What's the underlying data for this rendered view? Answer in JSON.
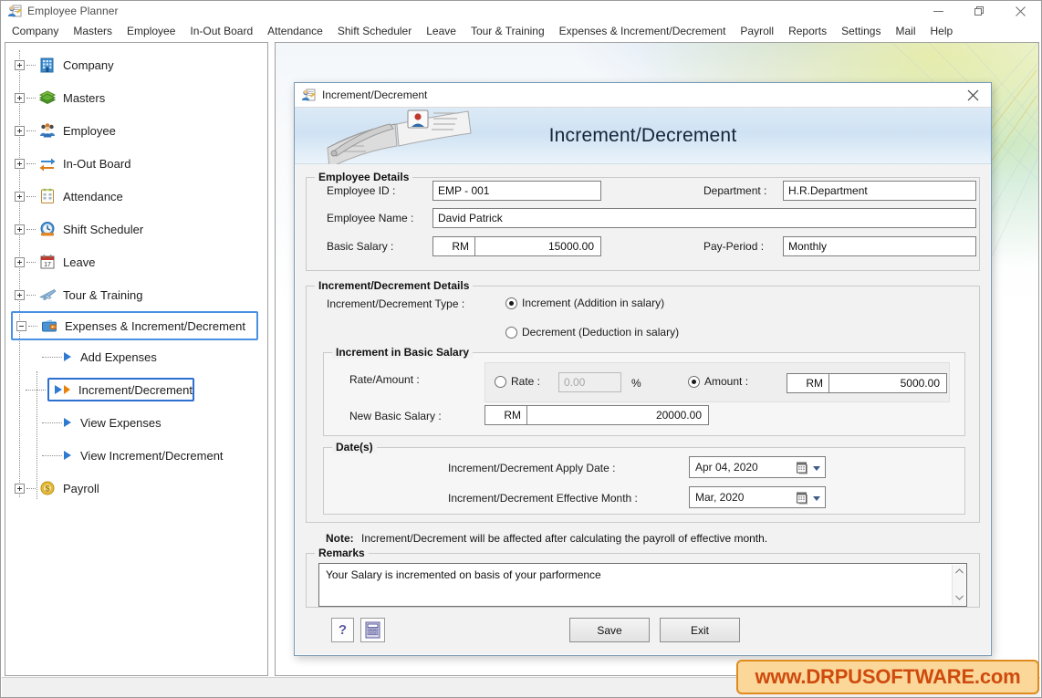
{
  "window": {
    "title": "Employee Planner",
    "app_icon": "employee-planner-icon",
    "minimize": "—",
    "maximize": "❐",
    "close": "✕"
  },
  "menubar": {
    "items": [
      "Company",
      "Masters",
      "Employee",
      "In-Out Board",
      "Attendance",
      "Shift Scheduler",
      "Leave",
      "Tour & Training",
      "Expenses & Increment/Decrement",
      "Payroll",
      "Reports",
      "Settings",
      "Mail",
      "Help"
    ]
  },
  "sidebar": {
    "nodes": [
      {
        "label": "Company",
        "icon": "building-icon",
        "state": "collapsed"
      },
      {
        "label": "Masters",
        "icon": "layers-icon",
        "state": "collapsed"
      },
      {
        "label": "Employee",
        "icon": "people-icon",
        "state": "collapsed"
      },
      {
        "label": "In-Out Board",
        "icon": "arrows-swap-icon",
        "state": "collapsed"
      },
      {
        "label": "Attendance",
        "icon": "clipboard-icon",
        "state": "collapsed"
      },
      {
        "label": "Shift Scheduler",
        "icon": "clock-icon",
        "state": "collapsed"
      },
      {
        "label": "Leave",
        "icon": "calendar-17-icon",
        "state": "collapsed"
      },
      {
        "label": "Tour & Training",
        "icon": "airplane-icon",
        "state": "collapsed"
      },
      {
        "label": "Expenses & Increment/Decrement",
        "icon": "wallet-icon",
        "state": "expanded",
        "selected": true
      },
      {
        "label": "Payroll",
        "icon": "coin-icon",
        "state": "collapsed"
      }
    ],
    "children": [
      {
        "label": "Add Expenses",
        "icon": "arrow-right-icon",
        "selected": false
      },
      {
        "label": "Increment/Decrement",
        "icon": "double-arrow-right-icon",
        "selected": true
      },
      {
        "label": "View Expenses",
        "icon": "arrow-right-icon",
        "selected": false
      },
      {
        "label": "View Increment/Decrement",
        "icon": "arrow-right-icon",
        "selected": false
      }
    ]
  },
  "dialog": {
    "titlebar": {
      "icon": "increment-decrement-icon",
      "title": "Increment/Decrement",
      "close": "✕"
    },
    "header": {
      "title": "Increment/Decrement",
      "image": "notebook-pen-icon"
    },
    "employee_details": {
      "legend": "Employee Details",
      "employee_id_label": "Employee ID :",
      "employee_id_value": "EMP - 001",
      "department_label": "Department :",
      "department_value": "H.R.Department",
      "employee_name_label": "Employee Name :",
      "employee_name_value": "David Patrick",
      "basic_salary_label": "Basic Salary :",
      "basic_salary_currency": "RM",
      "basic_salary_value": "15000.00",
      "pay_period_label": "Pay-Period :",
      "pay_period_value": "Monthly"
    },
    "incdec_details": {
      "legend": "Increment/Decrement Details",
      "type_label": "Increment/Decrement Type :",
      "option_increment": "Increment (Addition in salary)",
      "option_decrement": "Decrement (Deduction in salary)",
      "selected_type": "increment",
      "basic_salary_group": {
        "legend": "Increment in Basic Salary",
        "rate_amount_label": "Rate/Amount :",
        "rate_radio_label": "Rate :",
        "rate_placeholder": "0.00",
        "rate_value": "",
        "percent_symbol": "%",
        "amount_radio_label": "Amount :",
        "amount_currency": "RM",
        "amount_value": "5000.00",
        "selected_mode": "amount",
        "new_basic_salary_label": "New Basic Salary :",
        "new_basic_salary_currency": "RM",
        "new_basic_salary_value": "20000.00"
      },
      "dates_group": {
        "legend": "Date(s)",
        "apply_date_label": "Increment/Decrement Apply Date :",
        "apply_date_value": "Apr 04, 2020",
        "effective_month_label": "Increment/Decrement Effective Month :",
        "effective_month_value": "Mar, 2020",
        "calendar_icon": "calendar-icon",
        "dropdown_icon": "chevron-down-icon"
      }
    },
    "note": {
      "prefix": "Note:",
      "text": "Increment/Decrement will be affected after calculating the payroll of effective month."
    },
    "remarks": {
      "legend": "Remarks",
      "value": "Your Salary is incremented on basis of your parformence",
      "scroll_up": "⌃",
      "scroll_down": "⌄"
    },
    "footer": {
      "help_icon": "question-mark-icon",
      "calculator_icon": "calculator-icon",
      "save_label": "Save",
      "exit_label": "Exit"
    }
  },
  "watermark": {
    "text": "www.DRPUSOFTWARE.com"
  },
  "colors": {
    "accent_blue": "#4a90e2",
    "selection_blue": "#2c6fd1",
    "orange_arrow": "#e8820c",
    "watermark_bg": "#fbd89a",
    "watermark_border": "#e08a1e",
    "watermark_text": "#cf4a0d",
    "dialog_header_top": "#ddeaf6"
  }
}
